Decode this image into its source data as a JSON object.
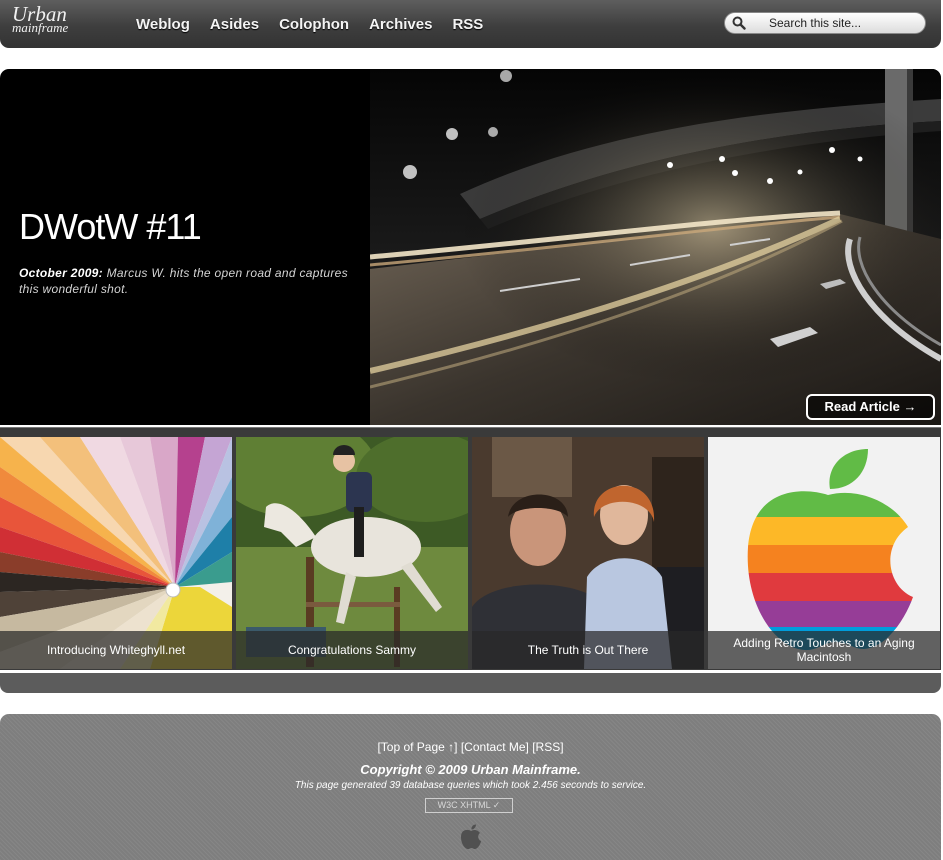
{
  "header": {
    "logo_line1": "Urban",
    "logo_line2": "mainframe",
    "nav": [
      "Weblog",
      "Asides",
      "Colophon",
      "Archives",
      "RSS"
    ],
    "search_placeholder": "Search this site..."
  },
  "hero": {
    "title": "DWotW #11",
    "caption_date": "October 2009:",
    "caption_text": "Marcus W. hits the open road and captures this wonderful shot.",
    "read_more": "Read Article →"
  },
  "thumbnails": [
    {
      "caption": "Introducing Whiteghyll.net"
    },
    {
      "caption": "Congratulations Sammy"
    },
    {
      "caption": "The Truth is Out There"
    },
    {
      "caption": "Adding Retro Touches to an Aging Macintosh"
    }
  ],
  "footer": {
    "top_of_page": "[Top of Page ↑]",
    "contact": "[Contact Me]",
    "rss": "[RSS]",
    "copyright": "Copyright © 2009 Urban Mainframe.",
    "generated": "This page generated 39 database queries which took 2.456 seconds to service.",
    "badge": "W3C XHTML ✓"
  },
  "colors": {
    "header_bg": "#444444",
    "hero_bg": "#000000",
    "footer_bg": "#7e7e7e"
  }
}
